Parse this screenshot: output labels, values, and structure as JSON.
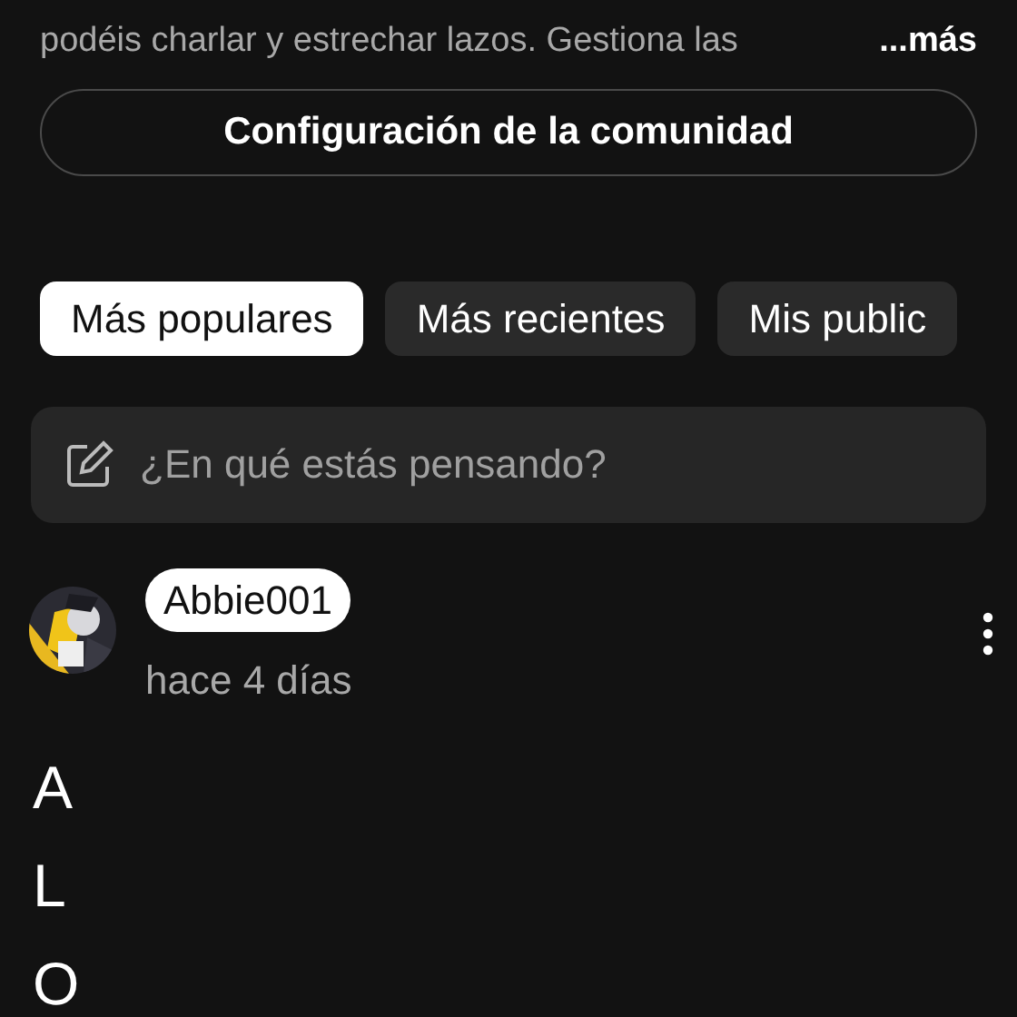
{
  "description": {
    "text": "podéis charlar y estrechar lazos. Gestiona las",
    "more": "...más"
  },
  "settings_button": "Configuración de la comunidad",
  "tabs": [
    {
      "label": "Más populares",
      "selected": true
    },
    {
      "label": "Más recientes",
      "selected": false
    },
    {
      "label": "Mis public",
      "selected": false
    }
  ],
  "composer": {
    "placeholder": "¿En qué estás pensando?"
  },
  "post": {
    "author": "Abbie001",
    "time": "hace 4 días",
    "lines": [
      "A",
      "L",
      "O"
    ]
  }
}
